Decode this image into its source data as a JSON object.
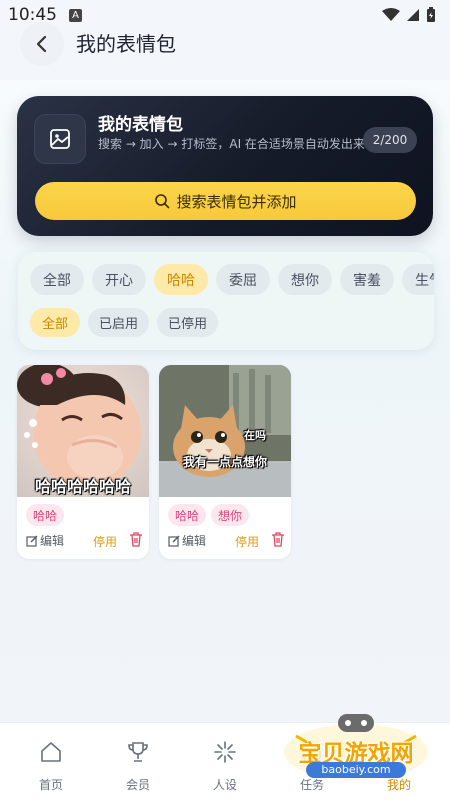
{
  "status": {
    "time": "10:45",
    "a_badge": "A"
  },
  "header": {
    "title": "我的表情包",
    "back_icon": "chevron-left-icon"
  },
  "hero": {
    "title": "我的表情包",
    "desc": "搜索 → 加入 → 打标签，AI 在合适场景自动发出来",
    "count": "2/200",
    "search_label": "搜索表情包并添加",
    "icon": "image-icon",
    "colors": {
      "bg": "#161b29",
      "accent": "#f7c93a"
    }
  },
  "filters": {
    "categories": [
      {
        "label": "全部",
        "active": false
      },
      {
        "label": "开心",
        "active": false
      },
      {
        "label": "哈哈",
        "active": true
      },
      {
        "label": "委屈",
        "active": false
      },
      {
        "label": "想你",
        "active": false
      },
      {
        "label": "害羞",
        "active": false
      },
      {
        "label": "生气",
        "active": false
      }
    ],
    "status": [
      {
        "label": "全部",
        "active": true
      },
      {
        "label": "已启用",
        "active": false
      },
      {
        "label": "已停用",
        "active": false
      }
    ]
  },
  "stickers": [
    {
      "caption": "哈哈哈哈哈哈",
      "tags": [
        "哈哈"
      ],
      "edit": "编辑",
      "disable": "停用"
    },
    {
      "caption_top": "在吗",
      "caption": "我有一点点想你",
      "tags": [
        "哈哈",
        "想你"
      ],
      "edit": "编辑",
      "disable": "停用"
    }
  ],
  "nav": {
    "items": [
      {
        "label": "首页",
        "icon": "home-icon"
      },
      {
        "label": "会员",
        "icon": "trophy-icon"
      },
      {
        "label": "人设",
        "icon": "sparkle-icon"
      },
      {
        "label": "任务",
        "icon": "task-icon"
      },
      {
        "label": "我的",
        "icon": "user-icon",
        "active": true
      }
    ]
  },
  "watermark": {
    "title": "宝贝游戏网",
    "url": "baobeiy.com"
  }
}
